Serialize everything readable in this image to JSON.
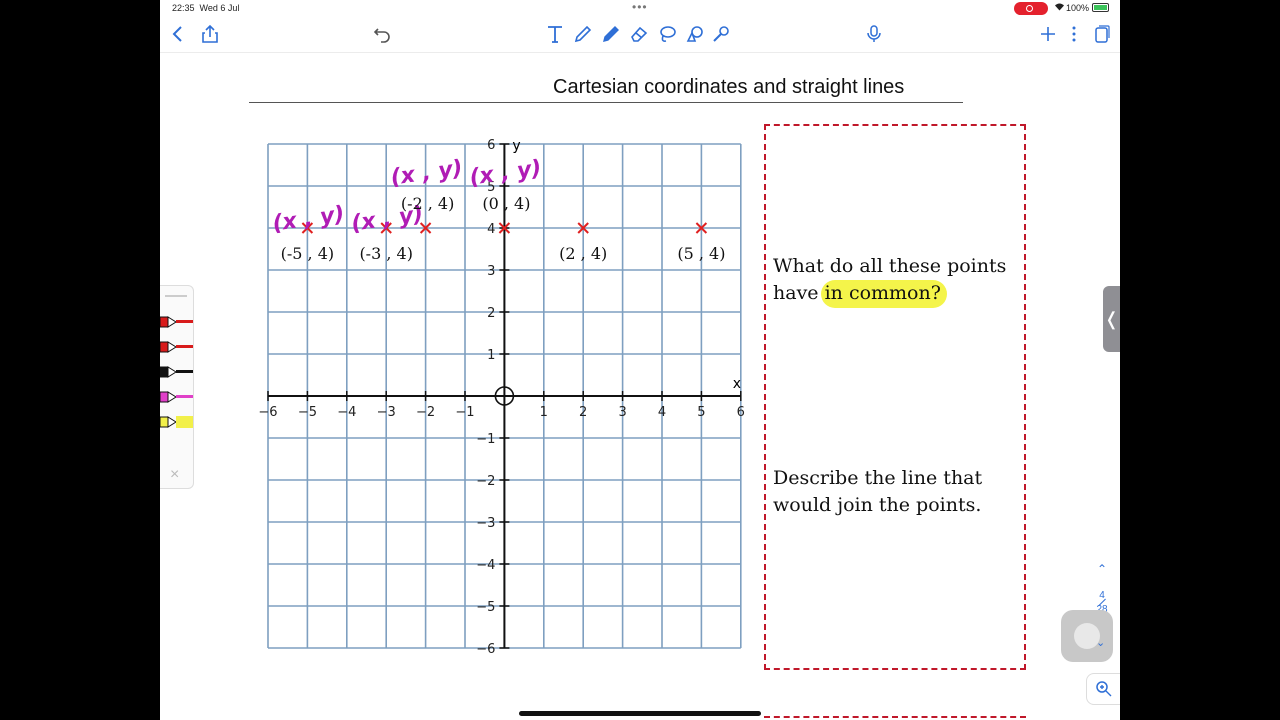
{
  "status": {
    "time": "22:35",
    "date": "Wed 6 Jul",
    "battery": "100%",
    "colors": {
      "record": "#e4212d",
      "battery_fill": "#3bc45a"
    }
  },
  "toolbar": {
    "accent": "#2f6fd6",
    "left_icons": [
      "back-icon",
      "share-icon",
      "undo-icon"
    ],
    "tool_icons": [
      "text-tool-icon",
      "pencil-tool-icon",
      "highlighter-tool-icon",
      "eraser-tool-icon",
      "lasso-tool-icon",
      "shape-tool-icon",
      "laser-tool-icon"
    ],
    "right_icons": [
      "microphone-icon",
      "add-icon",
      "more-icon",
      "pages-icon"
    ]
  },
  "page": {
    "title": "Cartesian coordinates and straight lines"
  },
  "graph": {
    "x_axis_label": "x",
    "y_axis_label": "y",
    "x_range": [
      -6,
      6
    ],
    "y_range": [
      -6,
      6
    ],
    "x_ticks": [
      "−6",
      "−5",
      "−4",
      "−3",
      "−2",
      "−1",
      "1",
      "2",
      "3",
      "4",
      "5",
      "6"
    ],
    "y_ticks": [
      "6",
      "5",
      "4",
      "3",
      "2",
      "1",
      "−1",
      "−2",
      "−3",
      "−4",
      "−5",
      "−6"
    ],
    "points": [
      {
        "x": -5,
        "y": 4,
        "label": "(-5 , 4)",
        "handwritten": "(x , y)"
      },
      {
        "x": -3,
        "y": 4,
        "label": "(-3 , 4)",
        "handwritten": "(x , y)"
      },
      {
        "x": -2,
        "y": 4,
        "label": "(-2 , 4)",
        "handwritten": "(x , y)"
      },
      {
        "x": 0,
        "y": 4,
        "label": "(0 , 4)",
        "handwritten": "(x , y)"
      },
      {
        "x": 2,
        "y": 4,
        "label": "(2 , 4)"
      },
      {
        "x": 5,
        "y": 4,
        "label": "(5 , 4)"
      }
    ],
    "colors": {
      "grid": "#7e9fc0",
      "axes": "#111111",
      "marker": "#e02020",
      "ink": "#b01cb5"
    }
  },
  "questions": {
    "q1_line1": "What do all these points",
    "q1_line2_plain": "have ",
    "q1_line2_highlight": "in common?",
    "q2_line1": "Describe the line that",
    "q2_line2": "would join the points.",
    "colors": {
      "border": "#c0182a",
      "highlight": "#f4f44a"
    }
  },
  "pen_panel": {
    "pens": [
      "#d81b1b",
      "#d81b1b",
      "#111111",
      "#e040c8",
      "#f2f04a"
    ],
    "close": "×"
  },
  "pager": {
    "current": "4",
    "total": "28"
  }
}
